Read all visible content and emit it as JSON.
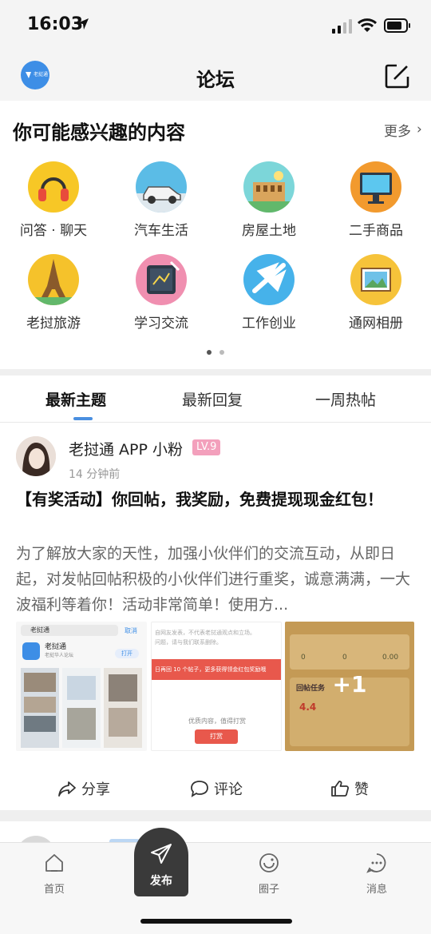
{
  "status_bar": {
    "time": "16:03"
  },
  "header": {
    "title": "论坛",
    "logo_text": "老挝通"
  },
  "interest": {
    "title": "你可能感兴趣的内容",
    "more": "更多",
    "categories": [
      {
        "label": "问答 · 聊天",
        "icon": "headphones-icon",
        "color": "#f7c726"
      },
      {
        "label": "汽车生活",
        "icon": "car-icon",
        "color": "#5bbce6"
      },
      {
        "label": "房屋土地",
        "icon": "building-icon",
        "color": "#7cd6d9"
      },
      {
        "label": "二手商品",
        "icon": "monitor-icon",
        "color": "#f29a2e"
      },
      {
        "label": "老挝旅游",
        "icon": "tower-icon",
        "color": "#f5c22b"
      },
      {
        "label": "学习交流",
        "icon": "tablet-icon",
        "color": "#f08fb0"
      },
      {
        "label": "工作创业",
        "icon": "airplane-icon",
        "color": "#46b2ea"
      },
      {
        "label": "通网相册",
        "icon": "photo-album-icon",
        "color": "#f6c33a"
      }
    ]
  },
  "tabs": [
    {
      "label": "最新主题",
      "active": true
    },
    {
      "label": "最新回复",
      "active": false
    },
    {
      "label": "一周热帖",
      "active": false
    }
  ],
  "post": {
    "username": "老挝通 APP 小粉",
    "level": "LV.9",
    "time": "14 分钟前",
    "title": "【有奖活动】你回帖，我奖励，免费提现现金红包！",
    "body": "为了解放大家的天性，加强小伙伴们的交流互动，从即日起，对发帖回帖积极的小伙伴们进行重奖，诚意满满，一大波福利等着你！活动非常简单！使用方...",
    "more_images": "+1",
    "thumb1": {
      "search": "老挝通",
      "cancel": "取消",
      "app_name": "老挝通",
      "app_sub": "老挝华人论坛",
      "open": "打开"
    },
    "thumb2": {
      "notice": "自网友发表，不代表老挝通观点和立场。",
      "notice2": "问题，请与我们联系删除。",
      "banner": "日再回 10 个帖子，更多获得领金红包奖励哦",
      "reward_text": "优质内容，值得打赏",
      "reward_btn": "打赏"
    },
    "thumb3": {
      "task_title": "回帖任务",
      "val_a": "0",
      "val_b": "0",
      "val_c": "0.00",
      "score": "4.4"
    },
    "actions": {
      "share": "分享",
      "comment": "评论",
      "like": "赞"
    }
  },
  "bottom_nav": {
    "home": "首页",
    "publish": "发布",
    "circle": "圈子",
    "messages": "消息"
  }
}
